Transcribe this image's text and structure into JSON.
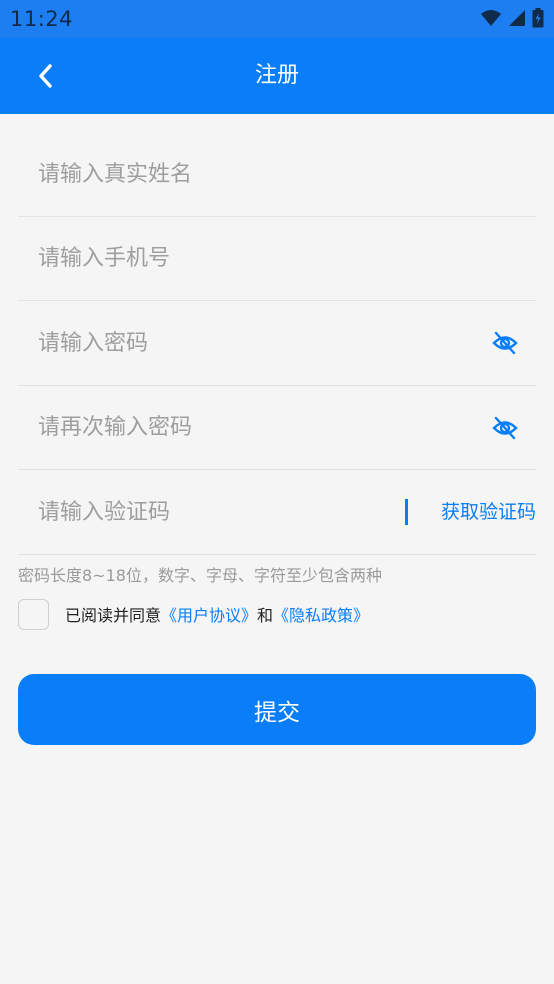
{
  "status_bar": {
    "time": "11:24"
  },
  "header": {
    "title": "注册"
  },
  "form": {
    "name_placeholder": "请输入真实姓名",
    "phone_placeholder": "请输入手机号",
    "password_placeholder": "请输入密码",
    "confirm_password_placeholder": "请再次输入密码",
    "code_placeholder": "请输入验证码",
    "get_code_label": "获取验证码"
  },
  "hint": "密码长度8~18位，数字、字母、字符至少包含两种",
  "agreement": {
    "prefix": "已阅读并同意",
    "user_agreement": "《用户协议》",
    "and": "和",
    "privacy_policy": "《隐私政策》"
  },
  "submit_label": "提交",
  "colors": {
    "primary": "#097ef8",
    "background": "#f5f5f5"
  }
}
